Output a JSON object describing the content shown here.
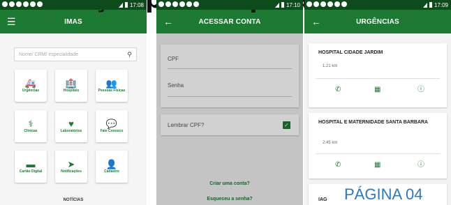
{
  "banner": {
    "text": "ção para o aplicativo"
  },
  "phone1": {
    "time": "17:08",
    "title": "IMAS",
    "search_placeholder": "Nome/ CRM/ especialidade",
    "tiles": [
      {
        "label": "Urgências",
        "icon": "ambulance-icon",
        "glyph": "🚑"
      },
      {
        "label": "Hospitais",
        "icon": "hospital-icon",
        "glyph": "🏥"
      },
      {
        "label": "Pessoas Físicas",
        "icon": "people-icon",
        "glyph": "👥"
      },
      {
        "label": "Clínicas",
        "icon": "doctor-icon",
        "glyph": "⚕"
      },
      {
        "label": "Laboratórios",
        "icon": "heartbeat-icon",
        "glyph": "♥"
      },
      {
        "label": "Fale Conosco",
        "icon": "chat-icon",
        "glyph": "💬"
      },
      {
        "label": "Cartão Digital",
        "icon": "card-icon",
        "glyph": "▬"
      },
      {
        "label": "Notificações",
        "icon": "send-icon",
        "glyph": "➤"
      },
      {
        "label": "Cadastro",
        "icon": "user-icon",
        "glyph": "👤"
      }
    ],
    "bottom_label": "NOTÍCIAS"
  },
  "phone2": {
    "time": "17:10",
    "title": "ACESSAR CONTA",
    "cpf_label": "CPF",
    "senha_label": "Senha",
    "remember_label": "Lembrar CPF?",
    "create_link": "Criar uma conta?",
    "forgot_link": "Esqueceu a senha?"
  },
  "phone3": {
    "time": "17:09",
    "title": "URGÊNCIAS",
    "hospitals": [
      {
        "name": "HOSPITAL CIDADE JARDIM",
        "distance": "1.21 km"
      },
      {
        "name": "HOSPITAL E MATERNIDADE SANTA BARBARA",
        "distance": "2.45 km"
      },
      {
        "name": "IAG",
        "distance": ""
      }
    ],
    "page_tag": "PÁGINA 04"
  },
  "colors": {
    "primary": "#1d7a32",
    "status": "#0d4a1c",
    "page_tag": "#2a79c7"
  }
}
